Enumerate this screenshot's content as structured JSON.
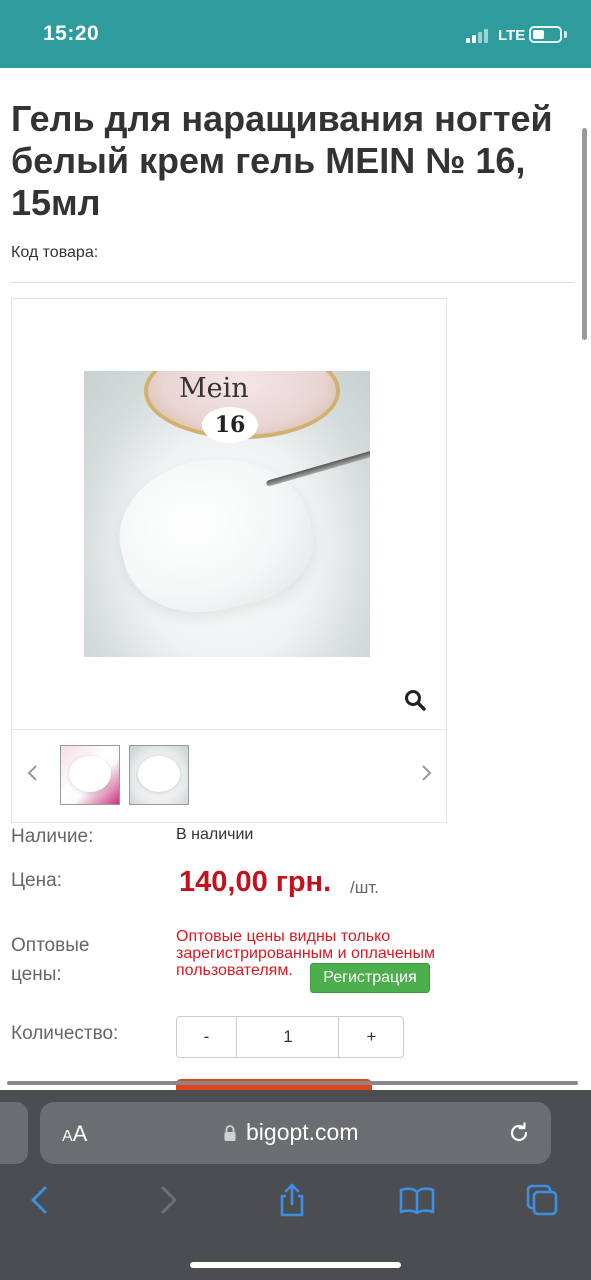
{
  "status_bar": {
    "time": "15:20",
    "network": "LTE",
    "icons": [
      "signal-icon",
      "battery-icon"
    ]
  },
  "product": {
    "title": "Гель для наращивания ногтей белый крем гель MEIN № 16, 15мл",
    "sku_label": "Код товара:",
    "photo_brand": "Mein",
    "photo_number": "16"
  },
  "details": {
    "availability_label": "Наличие:",
    "availability_value": "В наличии",
    "price_label": "Цена:",
    "price": "140,00 грн.",
    "price_unit": "/шт.",
    "wholesale_label_line1": "Оптовые",
    "wholesale_label_line2": "цены:",
    "wholesale_note": "Оптовые цены видны только зарегистрированным и оплаченым пользователям.",
    "register_button": "Регистрация",
    "quantity_label": "Количество:",
    "quantity_minus": "-",
    "quantity_value": "1",
    "quantity_plus": "+"
  },
  "browser": {
    "aa_small": "A",
    "aa_large": "A",
    "url": "bigopt.com",
    "toolbar_icons": [
      "back-icon",
      "forward-icon",
      "share-icon",
      "bookmarks-icon",
      "tabs-icon"
    ]
  },
  "colors": {
    "status_bar": "#2e9c9c",
    "price": "#c4121c",
    "wholesale_note": "#e0161e",
    "register_button": "#4cae4c",
    "browser_chrome": "#4b4d50",
    "toolbar_accent": "#3d8fe6"
  }
}
